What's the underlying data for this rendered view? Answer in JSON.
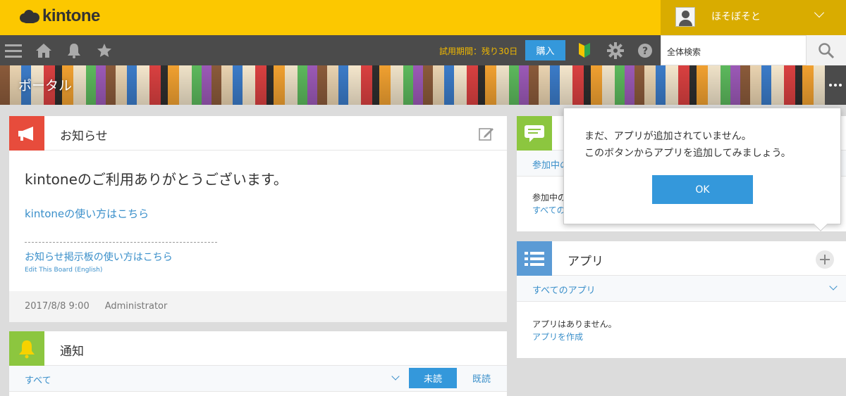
{
  "header": {
    "logo_text": "kintone",
    "user_name": "ほそぼそと"
  },
  "toolbar": {
    "icons": [
      "menu-icon",
      "home-icon",
      "bell-icon",
      "star-icon",
      "beginner-mark-icon",
      "gear-icon",
      "help-icon",
      "search-icon"
    ],
    "trial_text": "試用期間：残り30日",
    "buy_label": "購入",
    "search_placeholder": "全体検索"
  },
  "banner": {
    "title": "ポータル"
  },
  "notice": {
    "title": "お知らせ",
    "body_title": "kintoneのご利用ありがとうございます。",
    "link1": "kintoneの使い方はこちら",
    "link2": "お知らせ掲示板の使い方はこちら",
    "link3": "Edit This Board (English)",
    "date": "2017/8/8 9:00",
    "author": "Administrator"
  },
  "notifications": {
    "title": "通知",
    "filter": "すべて",
    "unread_label": "未読",
    "read_label": "既読"
  },
  "space": {
    "filter": "参加中の",
    "body_line1": "参加中の",
    "body_link": "すべての"
  },
  "apps": {
    "title": "アプリ",
    "filter": "すべてのアプリ",
    "empty_text": "アプリはありません。",
    "create_link": "アプリを作成"
  },
  "popover": {
    "line1": "まだ、アプリが追加されていません。",
    "line2": "このボタンからアプリを追加してみましょう。",
    "ok_label": "OK"
  },
  "colors": {
    "header_yellow": "#fcc800",
    "toolbar_gray": "#4b4b4b",
    "accent_blue": "#3498db",
    "notice_red": "#e74c3c",
    "notify_green": "#8cc63f",
    "apps_blue": "#5b9bd5"
  }
}
